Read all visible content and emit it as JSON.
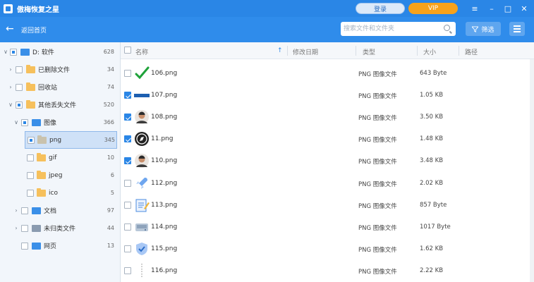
{
  "app": {
    "title": "傲梅恢复之星",
    "login_label": "登录",
    "vip_label": "VIP",
    "window_controls": [
      "≡",
      "–",
      "□",
      "✕"
    ]
  },
  "toolbar": {
    "back_label": "返回首页",
    "search_placeholder": "搜索文件和文件夹",
    "filter_label": "筛选"
  },
  "colors": {
    "titlebar": "#2a86e6",
    "toolbar": "#2f8ceb",
    "vip": "#f7a21b",
    "accent": "#2a86e6",
    "selected_row": "#cfe1f7"
  },
  "sidebar": {
    "items": [
      {
        "label": "D: 软件",
        "count": "628",
        "icon": "drive-icon"
      },
      {
        "label": "已删除文件",
        "count": "34",
        "icon": "folder-icon"
      },
      {
        "label": "回收站",
        "count": "74",
        "icon": "recycle-bin-icon"
      },
      {
        "label": "其他丢失文件",
        "count": "520",
        "icon": "folder-icon"
      },
      {
        "label": "图像",
        "count": "366",
        "icon": "image-icon"
      },
      {
        "label": "png",
        "count": "345",
        "icon": "folder-icon"
      },
      {
        "label": "gif",
        "count": "10",
        "icon": "folder-icon"
      },
      {
        "label": "jpeg",
        "count": "6",
        "icon": "folder-icon"
      },
      {
        "label": "ico",
        "count": "5",
        "icon": "folder-icon"
      },
      {
        "label": "文档",
        "count": "97",
        "icon": "document-icon"
      },
      {
        "label": "未归类文件",
        "count": "44",
        "icon": "unclassified-icon"
      },
      {
        "label": "网页",
        "count": "13",
        "icon": "webpage-icon"
      }
    ]
  },
  "table": {
    "headers": {
      "name": "名称",
      "modified": "修改日期",
      "type": "类型",
      "size": "大小",
      "path": "路径"
    },
    "sort_indicator": "↑",
    "rows": [
      {
        "name": "106.png",
        "type": "PNG 图像文件",
        "size": "643 Byte",
        "checked": false,
        "thumb": "green-check-icon"
      },
      {
        "name": "107.png",
        "type": "PNG 图像文件",
        "size": "1.05 KB",
        "checked": true,
        "thumb": "blue-bar-icon"
      },
      {
        "name": "108.png",
        "type": "PNG 图像文件",
        "size": "3.50 KB",
        "checked": true,
        "thumb": "person-avatar-icon"
      },
      {
        "name": "11.png",
        "type": "PNG 图像文件",
        "size": "1.48 KB",
        "checked": true,
        "thumb": "compass-icon"
      },
      {
        "name": "110.png",
        "type": "PNG 图像文件",
        "size": "3.48 KB",
        "checked": true,
        "thumb": "person-avatar-icon"
      },
      {
        "name": "112.png",
        "type": "PNG 图像文件",
        "size": "2.02 KB",
        "checked": false,
        "thumb": "rocket-icon"
      },
      {
        "name": "113.png",
        "type": "PNG 图像文件",
        "size": "857 Byte",
        "checked": false,
        "thumb": "notepad-icon"
      },
      {
        "name": "114.png",
        "type": "PNG 图像文件",
        "size": "1017 Byte",
        "checked": false,
        "thumb": "disk-icon"
      },
      {
        "name": "115.png",
        "type": "PNG 图像文件",
        "size": "1.62 KB",
        "checked": false,
        "thumb": "shield-icon"
      },
      {
        "name": "116.png",
        "type": "PNG 图像文件",
        "size": "2.22 KB",
        "checked": false,
        "thumb": "dotted-line-icon"
      }
    ]
  }
}
